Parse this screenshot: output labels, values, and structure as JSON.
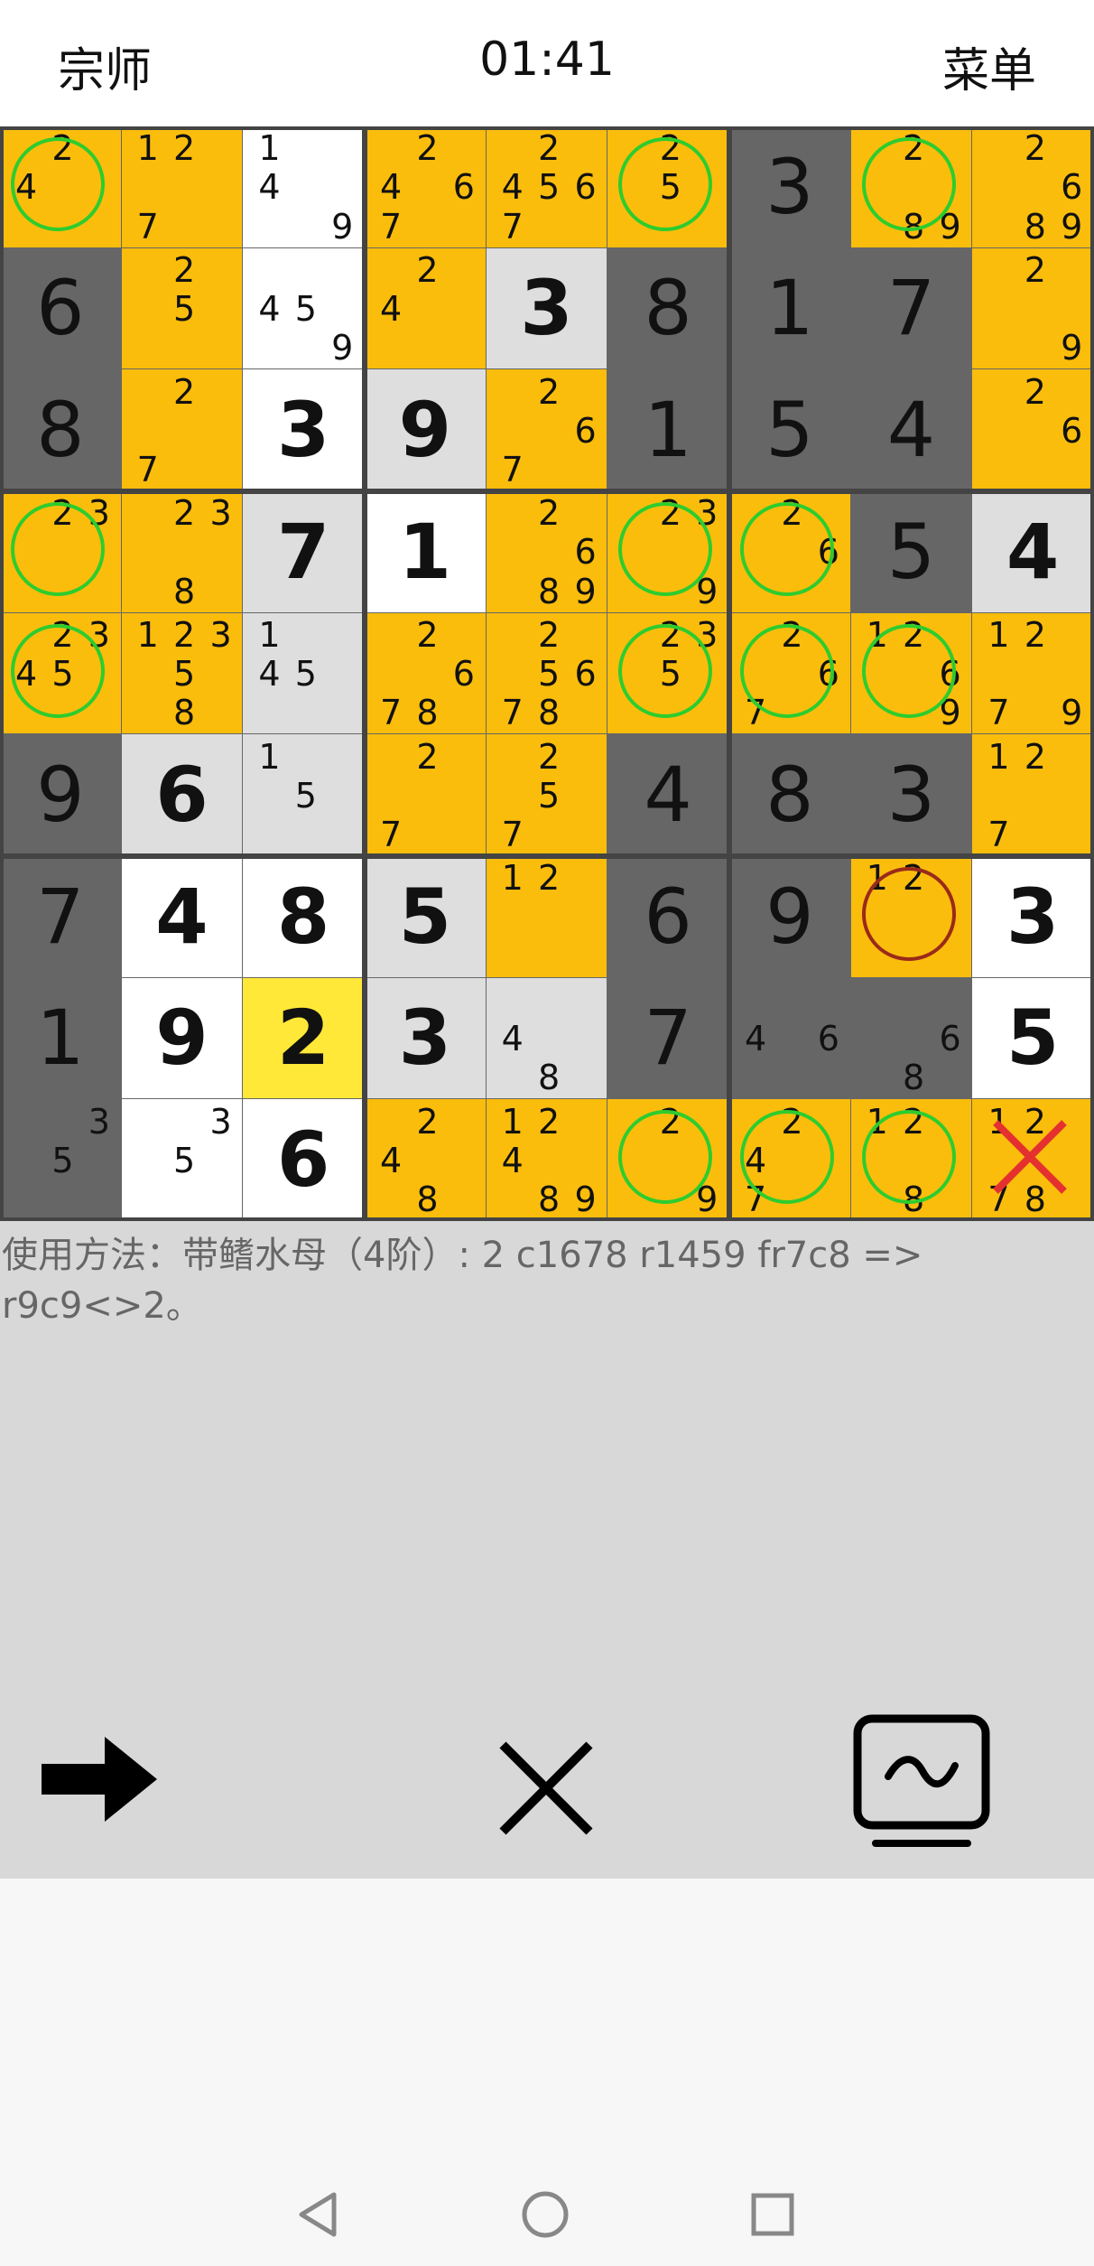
{
  "header": {
    "level": "宗师",
    "timer": "01:41",
    "menu": "菜单"
  },
  "hint": {
    "text": "使用方法：带鳍水母（4阶）: 2 c1678 r1459 fr7c8 => r9c9<>2。"
  },
  "controls": {
    "next_icon": "arrow-right-icon",
    "close_icon": "close-icon",
    "tv_icon": "tv-wave-icon"
  },
  "nav": {
    "back_icon": "triangle-back-icon",
    "home_icon": "circle-home-icon",
    "recent_icon": "square-recent-icon"
  },
  "colors": {
    "highlight": "#fbbd0c",
    "given": "#666666",
    "solved": "#dedede",
    "selected": "#ffe838",
    "fin_circle": "#2ecc2e",
    "target_circle": "#9a2a1a",
    "eliminate_x": "#e53030"
  },
  "grid": [
    [
      {
        "bg": "orange",
        "cands": "24",
        "circle": "fin"
      },
      {
        "bg": "orange",
        "cands": "127"
      },
      {
        "bg": "white",
        "cands": "149"
      },
      {
        "bg": "orange",
        "cands": "2467"
      },
      {
        "bg": "orange",
        "cands": "24567"
      },
      {
        "bg": "orange",
        "cands": "25",
        "circle": "fin"
      },
      {
        "bg": "dark",
        "value": "3"
      },
      {
        "bg": "orange",
        "cands": "289",
        "circle": "fin"
      },
      {
        "bg": "orange",
        "cands": "2689"
      }
    ],
    [
      {
        "bg": "dark",
        "value": "6"
      },
      {
        "bg": "orange",
        "cands": "25"
      },
      {
        "bg": "white",
        "cands": "459"
      },
      {
        "bg": "orange",
        "cands": "24"
      },
      {
        "bg": "lightgray",
        "value": "3"
      },
      {
        "bg": "dark",
        "value": "8"
      },
      {
        "bg": "dark",
        "value": "1"
      },
      {
        "bg": "dark",
        "value": "7"
      },
      {
        "bg": "orange",
        "cands": "29"
      }
    ],
    [
      {
        "bg": "dark",
        "value": "8"
      },
      {
        "bg": "orange",
        "cands": "27"
      },
      {
        "bg": "white",
        "value": "3"
      },
      {
        "bg": "lightgray",
        "value": "9"
      },
      {
        "bg": "orange",
        "cands": "267"
      },
      {
        "bg": "dark",
        "value": "1"
      },
      {
        "bg": "dark",
        "value": "5"
      },
      {
        "bg": "dark",
        "value": "4"
      },
      {
        "bg": "orange",
        "cands": "26"
      }
    ],
    [
      {
        "bg": "orange",
        "cands": "23",
        "circle": "fin"
      },
      {
        "bg": "orange",
        "cands": "238"
      },
      {
        "bg": "lightgray",
        "value": "7"
      },
      {
        "bg": "white",
        "value": "1"
      },
      {
        "bg": "orange",
        "cands": "2689"
      },
      {
        "bg": "orange",
        "cands": "239",
        "circle": "fin"
      },
      {
        "bg": "orange",
        "cands": "26",
        "circle": "fin"
      },
      {
        "bg": "dark",
        "value": "5"
      },
      {
        "bg": "lightgray",
        "value": "4"
      }
    ],
    [
      {
        "bg": "orange",
        "cands": "2345",
        "circle": "fin"
      },
      {
        "bg": "orange",
        "cands": "12358"
      },
      {
        "bg": "lightgray",
        "cands": "145"
      },
      {
        "bg": "orange",
        "cands": "2678"
      },
      {
        "bg": "orange",
        "cands": "25678"
      },
      {
        "bg": "orange",
        "cands": "235",
        "circle": "fin"
      },
      {
        "bg": "orange",
        "cands": "267",
        "circle": "fin"
      },
      {
        "bg": "orange",
        "cands": "1269",
        "circle": "fin"
      },
      {
        "bg": "orange",
        "cands": "1279"
      }
    ],
    [
      {
        "bg": "dark",
        "value": "9"
      },
      {
        "bg": "lightgray",
        "value": "6"
      },
      {
        "bg": "lightgray",
        "cands": "15"
      },
      {
        "bg": "orange",
        "cands": "27"
      },
      {
        "bg": "orange",
        "cands": "257"
      },
      {
        "bg": "dark",
        "value": "4"
      },
      {
        "bg": "dark",
        "value": "8"
      },
      {
        "bg": "dark",
        "value": "3"
      },
      {
        "bg": "orange",
        "cands": "127"
      }
    ],
    [
      {
        "bg": "dark",
        "value": "7"
      },
      {
        "bg": "white",
        "value": "4"
      },
      {
        "bg": "white",
        "value": "8"
      },
      {
        "bg": "lightgray",
        "value": "5"
      },
      {
        "bg": "orange",
        "cands": "12"
      },
      {
        "bg": "dark",
        "value": "6"
      },
      {
        "bg": "dark",
        "value": "9"
      },
      {
        "bg": "orange",
        "cands": "12",
        "circle": "target"
      },
      {
        "bg": "white",
        "value": "3"
      }
    ],
    [
      {
        "bg": "dark",
        "value": "1"
      },
      {
        "bg": "white",
        "value": "9"
      },
      {
        "bg": "yellow",
        "value": "2"
      },
      {
        "bg": "lightgray",
        "value": "3"
      },
      {
        "bg": "lightgray",
        "cands": "48"
      },
      {
        "bg": "dark",
        "value": "7"
      },
      {
        "bg": "dark",
        "cands": "46"
      },
      {
        "bg": "dark",
        "cands": "68"
      },
      {
        "bg": "white",
        "value": "5"
      }
    ],
    [
      {
        "bg": "dark",
        "cands": "35"
      },
      {
        "bg": "white",
        "cands": "35"
      },
      {
        "bg": "white",
        "value": "6"
      },
      {
        "bg": "orange",
        "cands": "248"
      },
      {
        "bg": "orange",
        "cands": "12489"
      },
      {
        "bg": "orange",
        "cands": "29",
        "circle": "fin"
      },
      {
        "bg": "orange",
        "cands": "247",
        "circle": "fin"
      },
      {
        "bg": "orange",
        "cands": "128",
        "circle": "fin"
      },
      {
        "bg": "orange",
        "cands": "1278",
        "mark": "eliminate"
      }
    ]
  ]
}
